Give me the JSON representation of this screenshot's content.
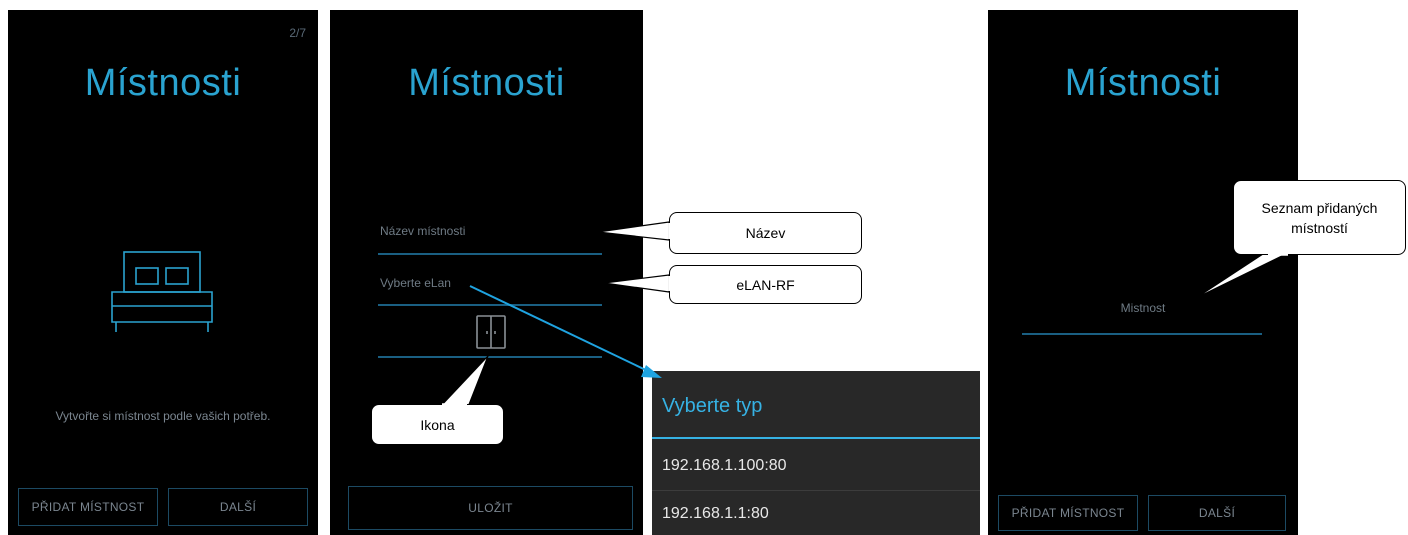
{
  "screen1": {
    "page_counter": "2/7",
    "title": "Místnosti",
    "icon": "bed-icon",
    "hint": "Vytvořte si místnost podle vašich potřeb.",
    "add_button": "PŘIDAT MÍSTNOST",
    "next_button": "DALŠÍ"
  },
  "screen2": {
    "title": "Místnosti",
    "room_name_placeholder": "Název místnosti",
    "elan_select_placeholder": "Vyberte eLan",
    "icon": "door-icon",
    "save_button": "ULOŽIT"
  },
  "popup": {
    "title": "Vyberte typ",
    "options": [
      "192.168.1.100:80",
      "192.168.1.1:80"
    ]
  },
  "screen3": {
    "title": "Místnosti",
    "room_item": "Mistnost",
    "add_button": "PŘIDAT MÍSTNOST",
    "next_button": "DALŠÍ"
  },
  "callouts": {
    "name": "Název",
    "elan": "eLAN-RF",
    "icon": "Ikona",
    "room_list": "Seznam přidaných místností"
  },
  "colors": {
    "accent": "#2aa3d0",
    "popup_accent": "#36b2e4",
    "arrow": "#1fa3e0",
    "screen_bg": "#000000",
    "popup_bg": "#282828"
  }
}
